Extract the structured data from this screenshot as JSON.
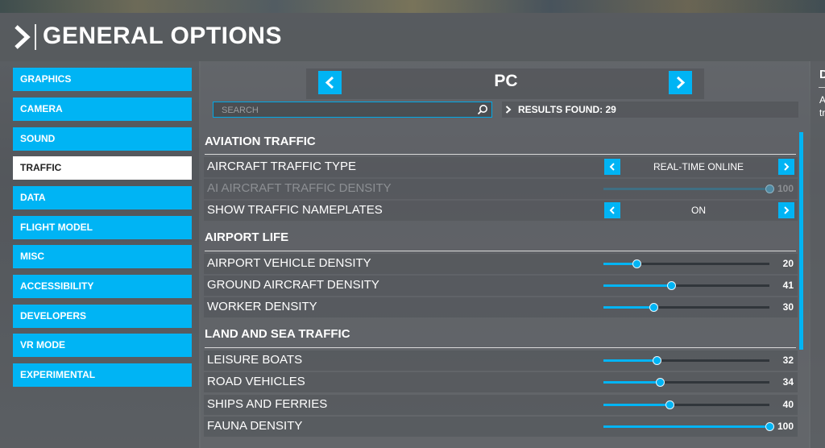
{
  "header": {
    "title": "GENERAL OPTIONS"
  },
  "sidebar": {
    "items": [
      {
        "label": "GRAPHICS"
      },
      {
        "label": "CAMERA"
      },
      {
        "label": "SOUND"
      },
      {
        "label": "TRAFFIC",
        "active": true
      },
      {
        "label": "DATA"
      },
      {
        "label": "FLIGHT MODEL"
      },
      {
        "label": "MISC"
      },
      {
        "label": "ACCESSIBILITY"
      },
      {
        "label": "DEVELOPERS"
      },
      {
        "label": "VR MODE"
      },
      {
        "label": "EXPERIMENTAL"
      }
    ]
  },
  "platform": {
    "title": "PC"
  },
  "search": {
    "placeholder": "SEARCH"
  },
  "results": {
    "text": "RESULTS FOUND: 29"
  },
  "sections": {
    "aviation": {
      "title": "AVIATION TRAFFIC"
    },
    "airport": {
      "title": "AIRPORT LIFE"
    },
    "landsea": {
      "title": "LAND AND SEA TRAFFIC"
    }
  },
  "settings": {
    "aircraft_traffic_type": {
      "label": "AIRCRAFT TRAFFIC TYPE",
      "value": "REAL-TIME ONLINE"
    },
    "ai_aircraft_traffic_density": {
      "label": "AI AIRCRAFT TRAFFIC DENSITY",
      "value": "100",
      "level": 100,
      "disabled": true
    },
    "show_traffic_nameplates": {
      "label": "SHOW TRAFFIC NAMEPLATES",
      "value": "ON"
    },
    "airport_vehicle_density": {
      "label": "AIRPORT VEHICLE DENSITY",
      "value": "20",
      "level": 20
    },
    "ground_aircraft_density": {
      "label": "GROUND AIRCRAFT DENSITY",
      "value": "41",
      "level": 41
    },
    "worker_density": {
      "label": "WORKER DENSITY",
      "value": "30",
      "level": 30
    },
    "leisure_boats": {
      "label": "LEISURE BOATS",
      "value": "32",
      "level": 32
    },
    "road_vehicles": {
      "label": "ROAD VEHICLES",
      "value": "34",
      "level": 34
    },
    "ships_and_ferries": {
      "label": "SHIPS AND FERRIES",
      "value": "40",
      "level": 40
    },
    "fauna_density": {
      "label": "FAUNA DENSITY",
      "value": "100",
      "level": 100
    }
  },
  "right_panel": {
    "heading": "D",
    "text_line1": "A",
    "text_line2": "tr"
  },
  "colors": {
    "accent": "#00b4f4",
    "active_tab": "#ffffff"
  }
}
